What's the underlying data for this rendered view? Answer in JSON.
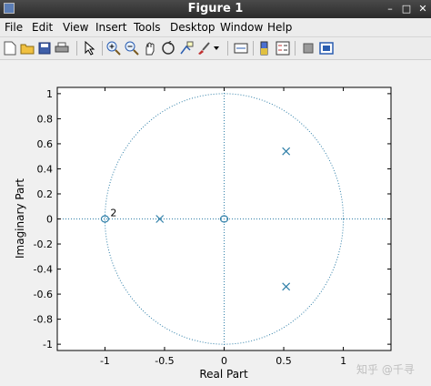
{
  "window": {
    "title": "Figure 1",
    "minimize_glyph": "–",
    "maximize_glyph": "□",
    "close_glyph": "✕"
  },
  "menu": [
    "File",
    "Edit",
    "View",
    "Insert",
    "Tools",
    "Desktop",
    "Window",
    "Help"
  ],
  "toolbar": [
    "new-figure-icon",
    "open-file-icon",
    "save-icon",
    "print-icon",
    "edit-plot-icon",
    "zoom-in-icon",
    "zoom-out-icon",
    "pan-icon",
    "rotate-3d-icon",
    "data-cursor-icon",
    "brush-icon",
    "brush-dropdown-icon",
    "link-plot-icon",
    "colorbar-icon",
    "legend-icon",
    "hide-plot-tools-icon",
    "show-plot-tools-icon"
  ],
  "watermark": "知乎 @千寻",
  "colors": {
    "accent": "#2f7fa8",
    "axis": "#000000"
  },
  "chart_data": {
    "type": "scatter",
    "title": "",
    "xlabel": "Real Part",
    "ylabel": "Imaginary Part",
    "xlim": [
      -1.4,
      1.4
    ],
    "ylim": [
      -1.05,
      1.05
    ],
    "xticks": [
      "-1",
      "-0.5",
      "0",
      "0.5",
      "1"
    ],
    "xtick_values": [
      -1,
      -0.5,
      0,
      0.5,
      1
    ],
    "yticks": [
      "-1",
      "-0.8",
      "-0.6",
      "-0.4",
      "-0.2",
      "0",
      "0.2",
      "0.4",
      "0.6",
      "0.8",
      "1"
    ],
    "ytick_values": [
      -1,
      -0.8,
      -0.6,
      -0.4,
      -0.2,
      0,
      0.2,
      0.4,
      0.6,
      0.8,
      1
    ],
    "unit_circle": true,
    "series": [
      {
        "name": "zeros",
        "marker": "o",
        "points": [
          [
            -1,
            0
          ],
          [
            0,
            0
          ]
        ]
      },
      {
        "name": "poles",
        "marker": "x",
        "points": [
          [
            -0.54,
            0
          ],
          [
            0.52,
            0.54
          ],
          [
            0.52,
            -0.54
          ]
        ]
      }
    ],
    "annotations": [
      {
        "x": -1,
        "y": 0,
        "text": "2"
      }
    ]
  }
}
